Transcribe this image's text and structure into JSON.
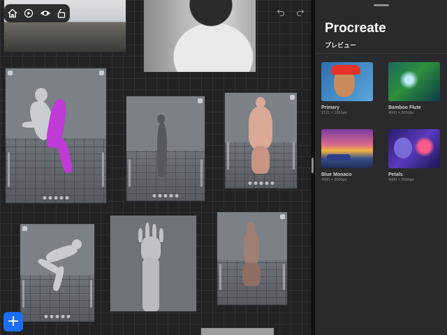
{
  "toolbar": {
    "icons": [
      "home-icon",
      "play-icon",
      "eye-icon",
      "lock-icon"
    ]
  },
  "canvas_controls": {
    "undo_icon": "undo-icon",
    "redo_icon": "redo-icon",
    "add_label": "+"
  },
  "panel": {
    "title": "Procreate",
    "subtitle": "プレビュー",
    "items": [
      {
        "name": "Primary",
        "size": "2121 × 1591px"
      },
      {
        "name": "Bamboo Flute",
        "size": "4000 × 3000px"
      },
      {
        "name": "Blue Monaco",
        "size": "4000 × 3000px"
      },
      {
        "name": "Petals",
        "size": "4000 × 3000px"
      }
    ]
  },
  "colors": {
    "accent": "#1a6ef5",
    "panel_bg": "#2a2a2c",
    "canvas_bg": "#222224",
    "highlight_figure": "#c03ad6"
  }
}
